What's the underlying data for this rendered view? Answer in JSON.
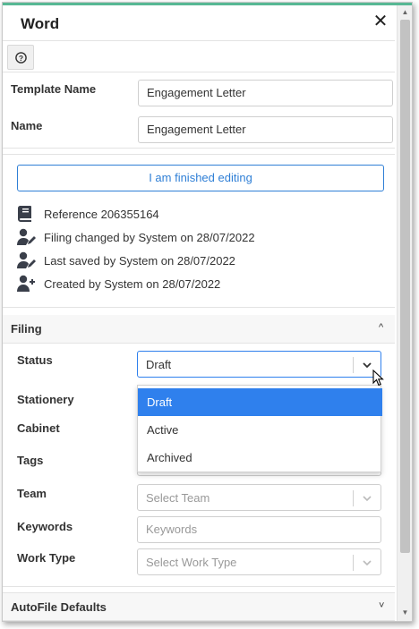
{
  "window": {
    "title": "Word",
    "close_glyph": "✕"
  },
  "help": {
    "icon": "help-circle-icon",
    "glyph": "?"
  },
  "fields": {
    "template_name": {
      "label": "Template Name",
      "value": "Engagement Letter"
    },
    "name": {
      "label": "Name",
      "value": "Engagement Letter"
    }
  },
  "finish_button": "I am finished editing",
  "meta": {
    "reference": "Reference 206355164",
    "filing_changed": "Filing changed by System on 28/07/2022",
    "last_saved": "Last saved by System on 28/07/2022",
    "created": "Created by System on 28/07/2022"
  },
  "filing": {
    "title": "Filing",
    "collapse_glyph": "^",
    "status": {
      "label": "Status",
      "value": "Draft"
    },
    "stationery": {
      "label": "Stationery"
    },
    "cabinet": {
      "label": "Cabinet"
    },
    "tags": {
      "label": "Tags"
    },
    "team": {
      "label": "Team",
      "placeholder": "Select Team"
    },
    "keywords": {
      "label": "Keywords",
      "placeholder": "Keywords"
    },
    "work_type": {
      "label": "Work Type",
      "placeholder": "Select Work Type"
    }
  },
  "status_options": [
    "Draft",
    "Active",
    "Archived"
  ],
  "autofile": {
    "title": "AutoFile Defaults",
    "expand_glyph": "˅"
  },
  "colors": {
    "accent": "#2f80ed",
    "topline": "#57b894",
    "button_text": "#2f7fd6"
  }
}
